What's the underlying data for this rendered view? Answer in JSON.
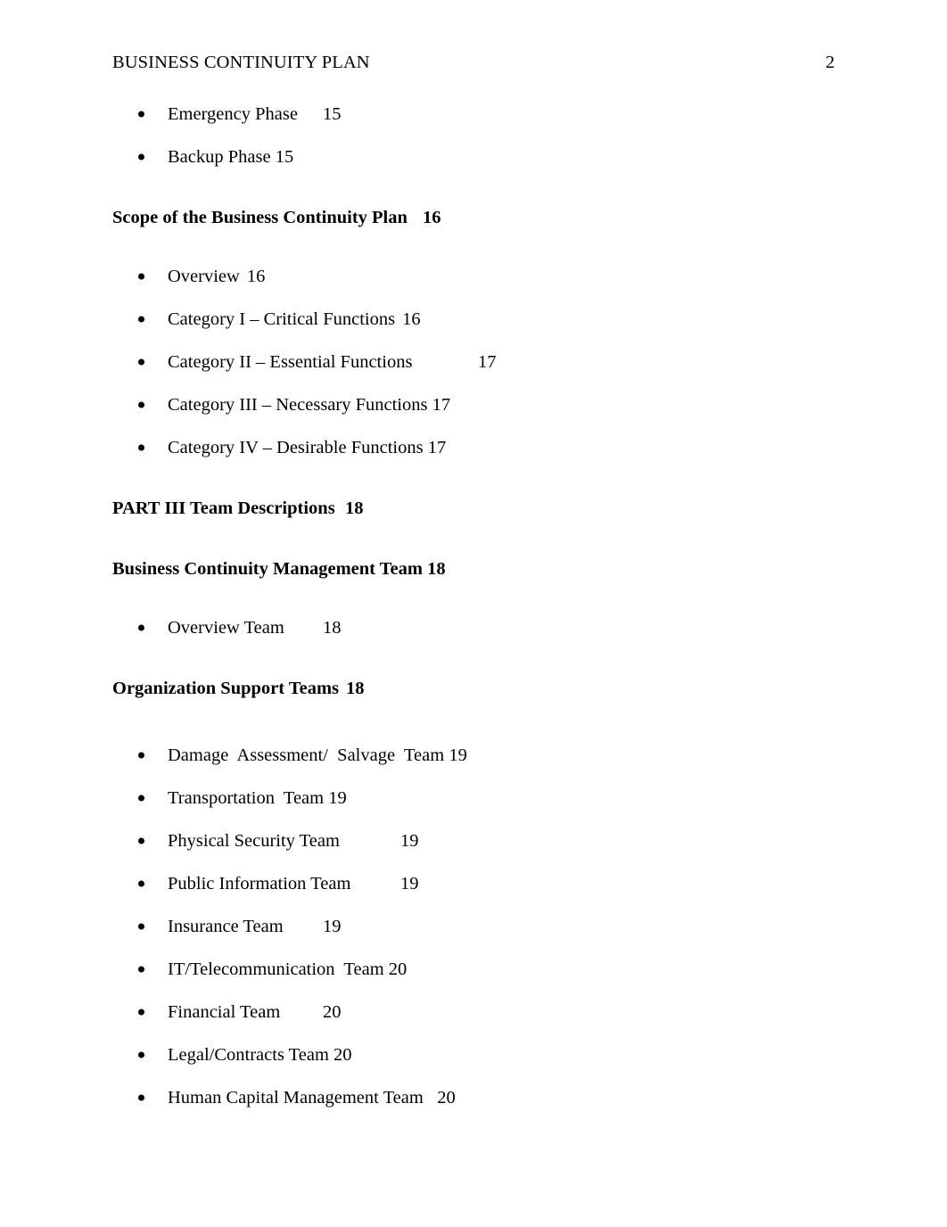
{
  "document": {
    "header": {
      "title": "BUSINESS CONTINUITY PLAN",
      "page_number": "2"
    }
  },
  "toc": {
    "phase_items": [
      {
        "label": "Emergency Phase",
        "gap": "\t",
        "page": "15"
      },
      {
        "label": "Backup Phase",
        "gap": " ",
        "page": "15"
      }
    ],
    "scope_heading": {
      "label": "Scope of the Business Continuity Plan",
      "gap": "\t",
      "page": "16"
    },
    "scope_items": [
      {
        "label": "Overview",
        "gap": "\t",
        "page": "16"
      },
      {
        "label": "Category I – Critical Functions",
        "gap": "\t",
        "page": "16"
      },
      {
        "label": "Category II – Essential Functions",
        "gap": "\t",
        "page": "17"
      },
      {
        "label": "Category III – Necessary Functions",
        "gap": " ",
        "page": "17"
      },
      {
        "label": "Category IV – Desirable Functions",
        "gap": " ",
        "page": "17"
      }
    ],
    "part_heading": {
      "label": "PART III Team Descriptions",
      "gap": "\t",
      "page": "18"
    },
    "bcmt_heading": {
      "label": "Business Continuity Management Team",
      "gap": " ",
      "page": "18"
    },
    "bcmt_items": [
      {
        "label": "Overview Team",
        "gap": "\t",
        "page": "18"
      }
    ],
    "ost_heading": {
      "label": "Organization Support Teams",
      "gap": "\t",
      "page": "18"
    },
    "ost_items": [
      {
        "label": "Damage  Assessment/  Salvage  Team",
        "gap": " ",
        "page": "19"
      },
      {
        "label": "Transportation  Team",
        "gap": " ",
        "page": "19"
      },
      {
        "label": "Physical Security Team",
        "gap": "\t",
        "page": "19"
      },
      {
        "label": "Public Information Team",
        "gap": "\t",
        "page": "19"
      },
      {
        "label": "Insurance Team",
        "gap": "\t",
        "page": "19"
      },
      {
        "label": "IT/Telecommunication  Team",
        "gap": " ",
        "page": "20"
      },
      {
        "label": "Financial Team",
        "gap": "\t",
        "page": "20"
      },
      {
        "label": "Legal/Contracts Team",
        "gap": " ",
        "page": "20"
      },
      {
        "label": "Human Capital Management Team",
        "gap": "   ",
        "page": "20"
      }
    ]
  }
}
